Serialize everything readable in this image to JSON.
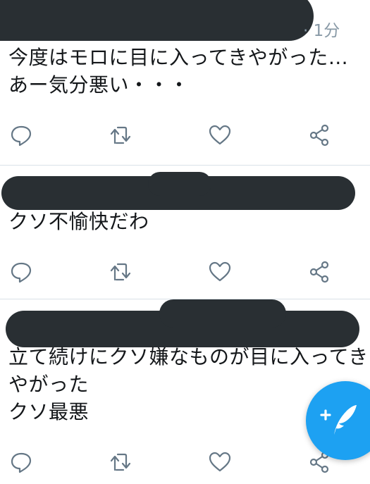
{
  "tweets": [
    {
      "time": "· 1分",
      "lines": [
        "今度はモロに目に入ってきやがった…",
        "あー気分悪い・・・"
      ]
    },
    {
      "lines": [
        "クソ不愉快だわ"
      ]
    },
    {
      "lines": [
        "立て続けにクソ嫌なものが目に入ってき",
        "やがった",
        "クソ最悪"
      ]
    }
  ],
  "actions": {
    "reply": "reply-icon",
    "retweet": "retweet-icon",
    "like": "heart-icon",
    "share": "share-icon"
  },
  "compose_button": {
    "icon": "compose-plus-feather-icon"
  },
  "colors": {
    "accent": "#1da1f2",
    "redaction": "#292f33",
    "icon_gray": "#657786",
    "meta_gray": "#8899a6",
    "divider": "#d9e1e8"
  }
}
